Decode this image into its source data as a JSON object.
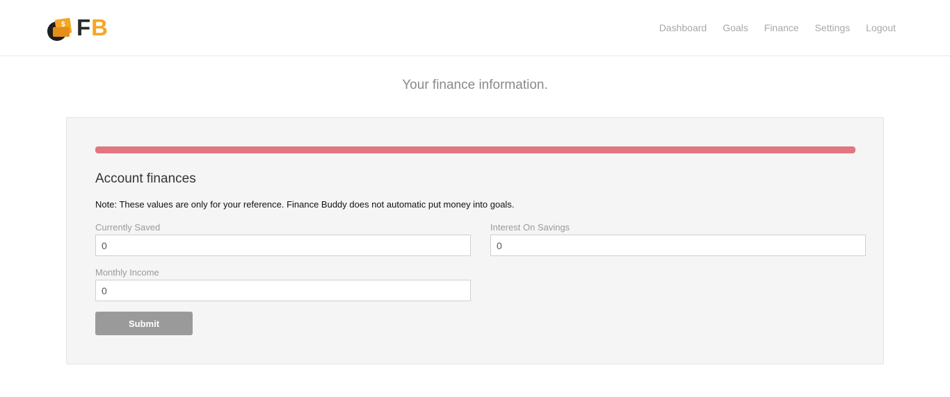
{
  "brand": {
    "letters_f": "F",
    "letters_b": "B",
    "accent_color": "#f5a623",
    "dark_color": "#2b2b2b"
  },
  "nav": {
    "items": [
      {
        "label": "Dashboard"
      },
      {
        "label": "Goals"
      },
      {
        "label": "Finance"
      },
      {
        "label": "Settings"
      },
      {
        "label": "Logout"
      }
    ]
  },
  "page": {
    "title": "Your finance information."
  },
  "progress": {
    "fraction": 1.0,
    "color": "#e0767f"
  },
  "finances": {
    "heading": "Account finances",
    "note": "Note: These values are only for your reference. Finance Buddy does not automatic put money into goals.",
    "fields": {
      "currently_saved": {
        "label": "Currently Saved",
        "value": "0"
      },
      "interest_on_savings": {
        "label": "Interest On Savings",
        "value": "0"
      },
      "monthly_income": {
        "label": "Monthly Income",
        "value": "0"
      }
    },
    "submit_label": "Submit"
  }
}
